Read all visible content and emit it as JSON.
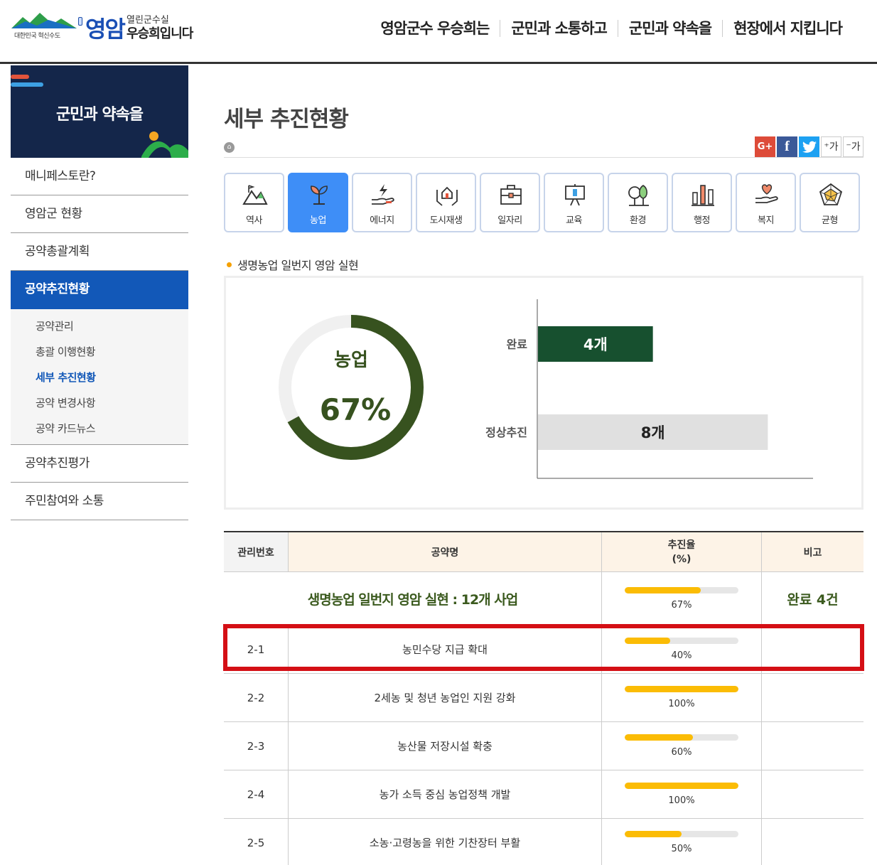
{
  "header": {
    "logo_tagline": "대한민국 혁신수도",
    "logo_brand": "영암",
    "logo_sub1": "열린군수실",
    "logo_sub2": "우승희입니다",
    "gnb": [
      "영암군수 우승희는",
      "군민과 소통하고",
      "군민과 약속을",
      "현장에서 지킵니다"
    ]
  },
  "sidebar": {
    "banner_title": "군민과 약속을",
    "items": [
      {
        "label": "매니페스토란?"
      },
      {
        "label": "영암군 현황"
      },
      {
        "label": "공약총괄계획"
      },
      {
        "label": "공약추진현황"
      }
    ],
    "subitems": [
      {
        "label": "공약관리"
      },
      {
        "label": "총괄 이행현황"
      },
      {
        "label": "세부 추진현황"
      },
      {
        "label": "공약 변경사항"
      },
      {
        "label": "공약 카드뉴스"
      }
    ],
    "items_after": [
      {
        "label": "공약추진평가"
      },
      {
        "label": "주민참여와 소통"
      }
    ]
  },
  "content": {
    "page_title": "세부 추진현황",
    "sns": {
      "google": "G+",
      "facebook": "f",
      "font_up": "⁺가",
      "font_down": "⁻가"
    },
    "categories": [
      {
        "label": "역사",
        "icon": "mountain-flag-icon"
      },
      {
        "label": "농업",
        "icon": "sprout-icon"
      },
      {
        "label": "에너지",
        "icon": "energy-hand-icon"
      },
      {
        "label": "도시재생",
        "icon": "house-hands-icon"
      },
      {
        "label": "일자리",
        "icon": "briefcase-icon"
      },
      {
        "label": "교육",
        "icon": "board-icon"
      },
      {
        "label": "환경",
        "icon": "trees-icon"
      },
      {
        "label": "행정",
        "icon": "bars-icon"
      },
      {
        "label": "복지",
        "icon": "heart-hand-icon"
      },
      {
        "label": "균형",
        "icon": "radar-icon"
      }
    ],
    "active_category": "농업",
    "section_title": "생명농업 일번지 영암 실현"
  },
  "chart_data": [
    {
      "type": "pie",
      "title": "농업",
      "value_label": "67%",
      "value": 67,
      "colors": {
        "fill": "#37521f",
        "track": "#f0f0f0"
      }
    },
    {
      "type": "bar",
      "orientation": "horizontal",
      "categories": [
        "완료",
        "정상추진"
      ],
      "values": [
        4,
        8
      ],
      "value_labels": [
        "4개",
        "8개"
      ],
      "colors": [
        "#17502f",
        "#e0e0e0"
      ],
      "xlim": [
        0,
        9.6
      ]
    }
  ],
  "table": {
    "headers": {
      "no": "관리번호",
      "name": "공약명",
      "rate_line1": "추진율",
      "rate_line2": "(%)",
      "note": "비고"
    },
    "summary": {
      "name": "생명농업 일번지 영암 실현 : 12개 사업",
      "rate": 67,
      "rate_label": "67%",
      "note": "완료 4건"
    },
    "rows": [
      {
        "no": "2-1",
        "name": "농민수당 지급 확대",
        "rate": 40,
        "rate_label": "40%"
      },
      {
        "no": "2-2",
        "name": "2세농 및 청년 농업인 지원 강화",
        "rate": 100,
        "rate_label": "100%"
      },
      {
        "no": "2-3",
        "name": "농산물 저장시설 확충",
        "rate": 60,
        "rate_label": "60%"
      },
      {
        "no": "2-4",
        "name": "농가 소득 중심 농업정책 개발",
        "rate": 100,
        "rate_label": "100%"
      },
      {
        "no": "2-5",
        "name": "소농·고령농을 위한 기찬장터 부활",
        "rate": 50,
        "rate_label": "50%"
      }
    ]
  },
  "colors": {
    "accent": "#1258b8",
    "progress": "#fbbc05",
    "highlight": "#d40f15"
  }
}
